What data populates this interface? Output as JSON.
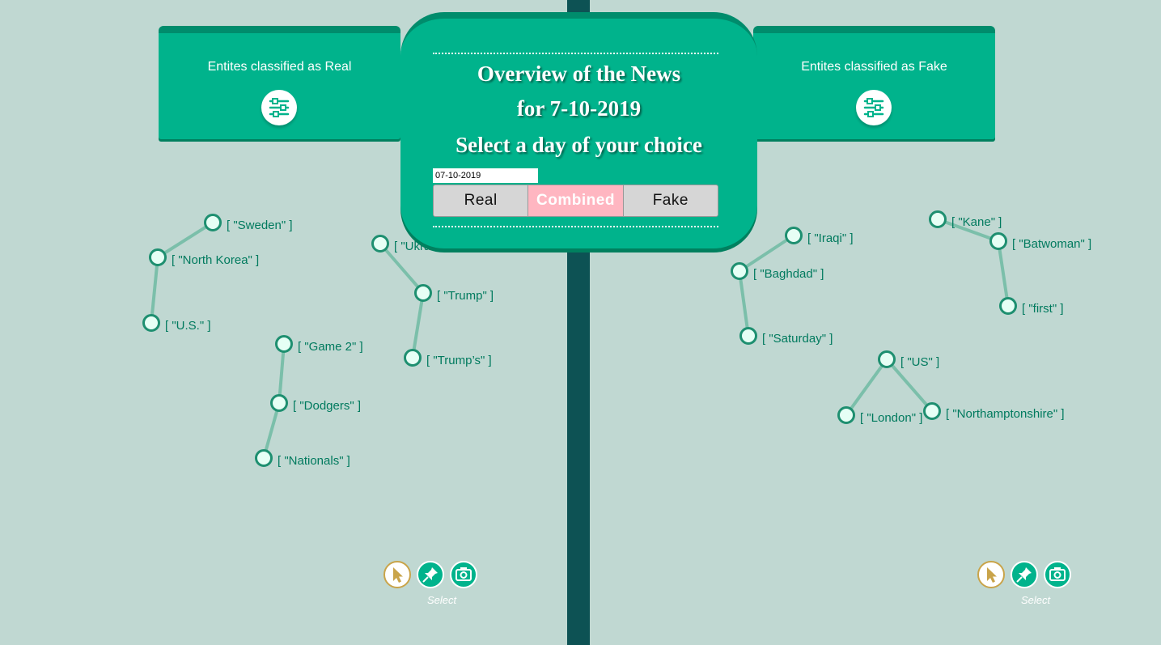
{
  "panels": {
    "real_title": "Entites classified as Real",
    "fake_title": "Entites classified as Fake"
  },
  "overview": {
    "line1": "Overview of the News",
    "line2": "for 7-10-2019",
    "line3": "Select a day of your choice",
    "date_value": "07-10-2019",
    "segments": [
      "Real",
      "Combined",
      "Fake"
    ],
    "selected_segment": "Combined"
  },
  "toolbar": {
    "mode_label": "Select",
    "icons": [
      "cursor-icon",
      "pin-icon",
      "camera-icon"
    ]
  },
  "graph": {
    "real_nodes": [
      {
        "label": "[ \"Sweden\" ]"
      },
      {
        "label": "[ \"North Korea\" ]"
      },
      {
        "label": "[ \"U.S.\" ]"
      },
      {
        "label": "[ \"Ukraine\" ]"
      },
      {
        "label": "[ \"Trump\" ]"
      },
      {
        "label": "[ \"Trump’s\" ]"
      },
      {
        "label": "[ \"Game 2\" ]"
      },
      {
        "label": "[ \"Dodgers\" ]"
      },
      {
        "label": "[ \"Nationals\" ]"
      }
    ],
    "fake_nodes": [
      {
        "label": "[ \"Iraqi\" ]"
      },
      {
        "label": "[ \"Baghdad\" ]"
      },
      {
        "label": "[ \"Saturday\" ]"
      },
      {
        "label": "[ \"Kane\" ]"
      },
      {
        "label": "[ \"Batwoman\" ]"
      },
      {
        "label": "[ \"first\" ]"
      },
      {
        "label": "[ \"US\" ]"
      },
      {
        "label": "[ \"London\" ]"
      },
      {
        "label": "[ \"Northamptonshire\" ]"
      }
    ]
  },
  "colors": {
    "background": "#c0d8d2",
    "panel": "#00b38c",
    "divider": "#0d5254",
    "node_fill": "#e6fff5",
    "node_stroke": "#1e8f70",
    "edge": "#7bbfaa",
    "label": "#007a5e",
    "active_segment": "#ffb6c1"
  }
}
